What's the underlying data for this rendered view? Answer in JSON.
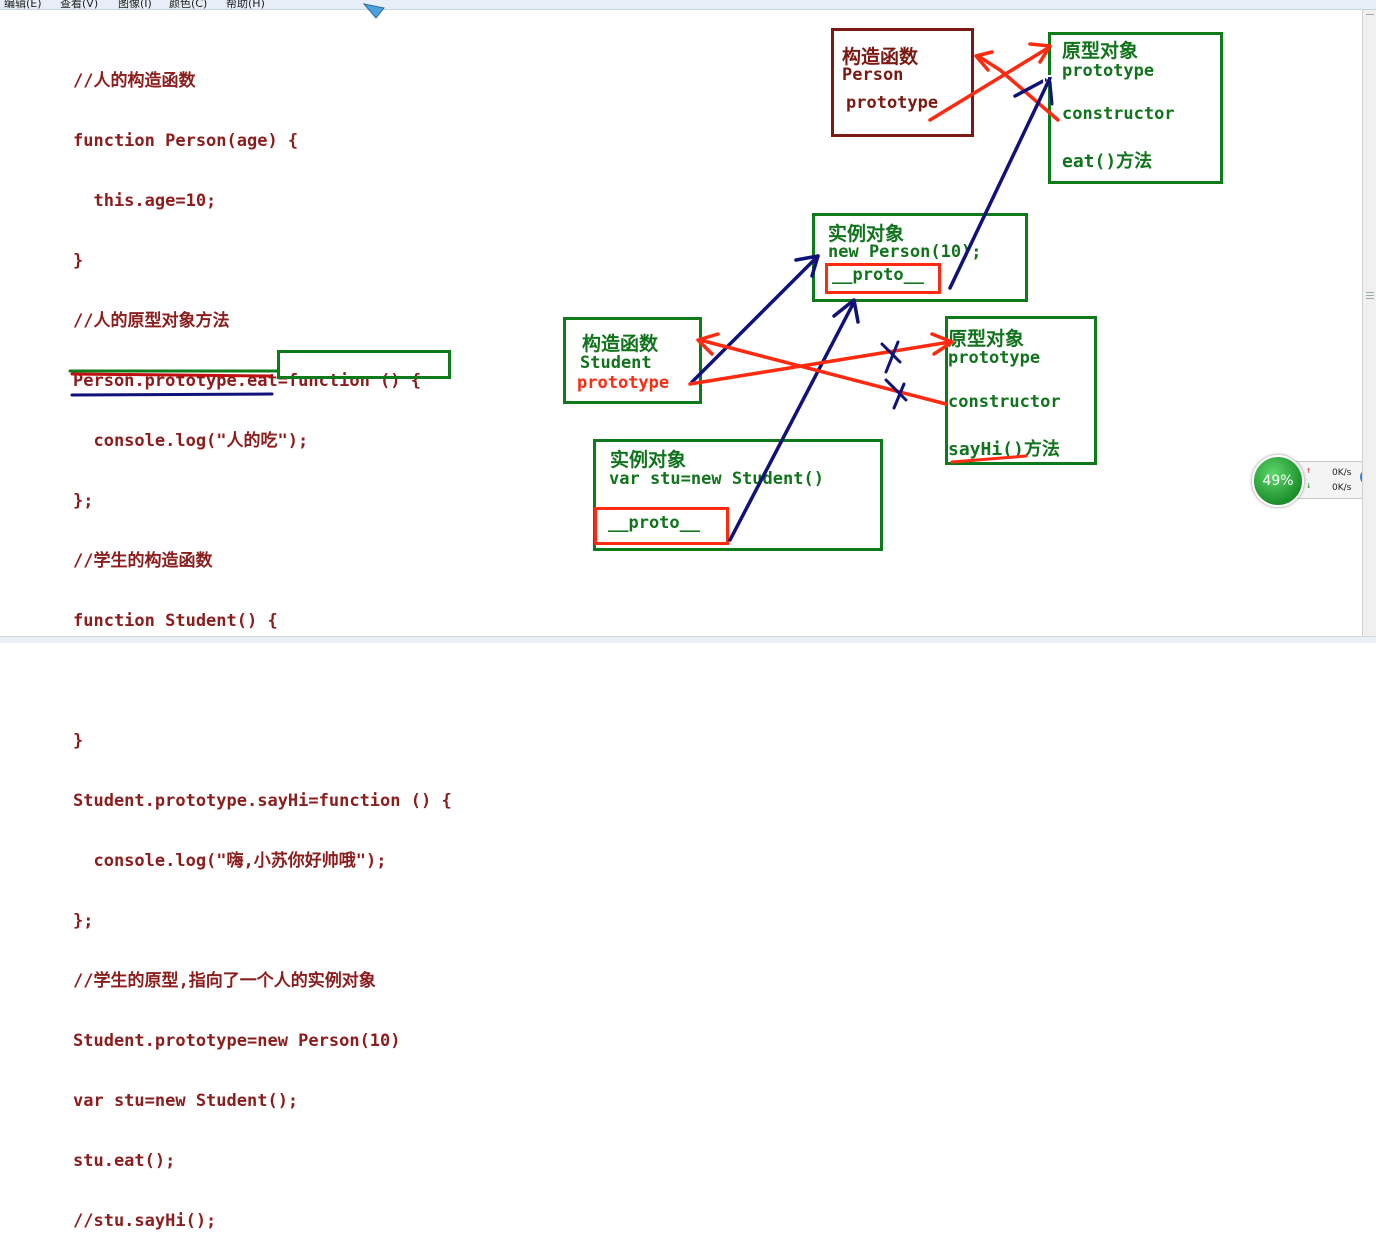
{
  "menu": {
    "items": [
      "编辑(E)",
      "查看(V)",
      "图像(I)",
      "颜色(C)",
      "帮助(H)"
    ]
  },
  "code_lines": [
    "//人的构造函数",
    "function Person(age) {",
    "  this.age=10;",
    "}",
    "//人的原型对象方法",
    "Person.prototype.eat=function () {",
    "  console.log(\"人的吃\");",
    "};",
    "//学生的构造函数",
    "function Student() {",
    "",
    "}",
    "Student.prototype.sayHi=function () {",
    "  console.log(\"嗨,小苏你好帅哦\");",
    "};",
    "//学生的原型,指向了一个人的实例对象",
    "Student.prototype=new Person(10)",
    "var stu=new Student();",
    "stu.eat();",
    "//stu.sayHi();"
  ],
  "diagram": {
    "person_ctor": {
      "title": "构造函数",
      "name": "Person",
      "prop": "prototype"
    },
    "person_proto": {
      "title": "原型对象",
      "prop": "prototype",
      "ctor": "constructor",
      "method": "eat()方法"
    },
    "person_instance": {
      "title": "实例对象",
      "expr": "new Person(10);",
      "proto": "__proto__"
    },
    "student_ctor": {
      "title": "构造函数",
      "name": "Student",
      "prop": "prototype"
    },
    "student_proto": {
      "title": "原型对象",
      "prop": "prototype",
      "ctor": "constructor",
      "method": "sayHi()方法"
    },
    "stu_instance": {
      "title": "实例对象",
      "expr": "var stu=new Student()",
      "proto": "__proto__"
    }
  },
  "net_widget": {
    "percent": "49%",
    "upload": "0K/s",
    "download": "0K/s"
  },
  "colors": {
    "code": "#8b1d1d",
    "green": "#12731d",
    "red": "#ff2a10",
    "blue": "#10127a",
    "maroon": "#7a1a12"
  }
}
